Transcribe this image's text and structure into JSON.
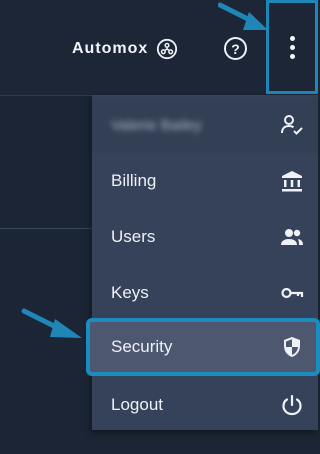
{
  "header": {
    "brand_name": "Automox",
    "help_glyph": "?"
  },
  "menu": {
    "items": [
      {
        "label": "Valerie Bailey",
        "icon": "user-check-icon"
      },
      {
        "label": "Billing",
        "icon": "bank-icon"
      },
      {
        "label": "Users",
        "icon": "users-icon"
      },
      {
        "label": "Keys",
        "icon": "key-icon"
      },
      {
        "label": "Security",
        "icon": "shield-icon"
      },
      {
        "label": "Logout",
        "icon": "power-icon"
      }
    ]
  },
  "colors": {
    "background": "#1b2535",
    "menu": "#36425a",
    "highlight": "#1a8cc0",
    "security_bg": "#4d5870"
  }
}
